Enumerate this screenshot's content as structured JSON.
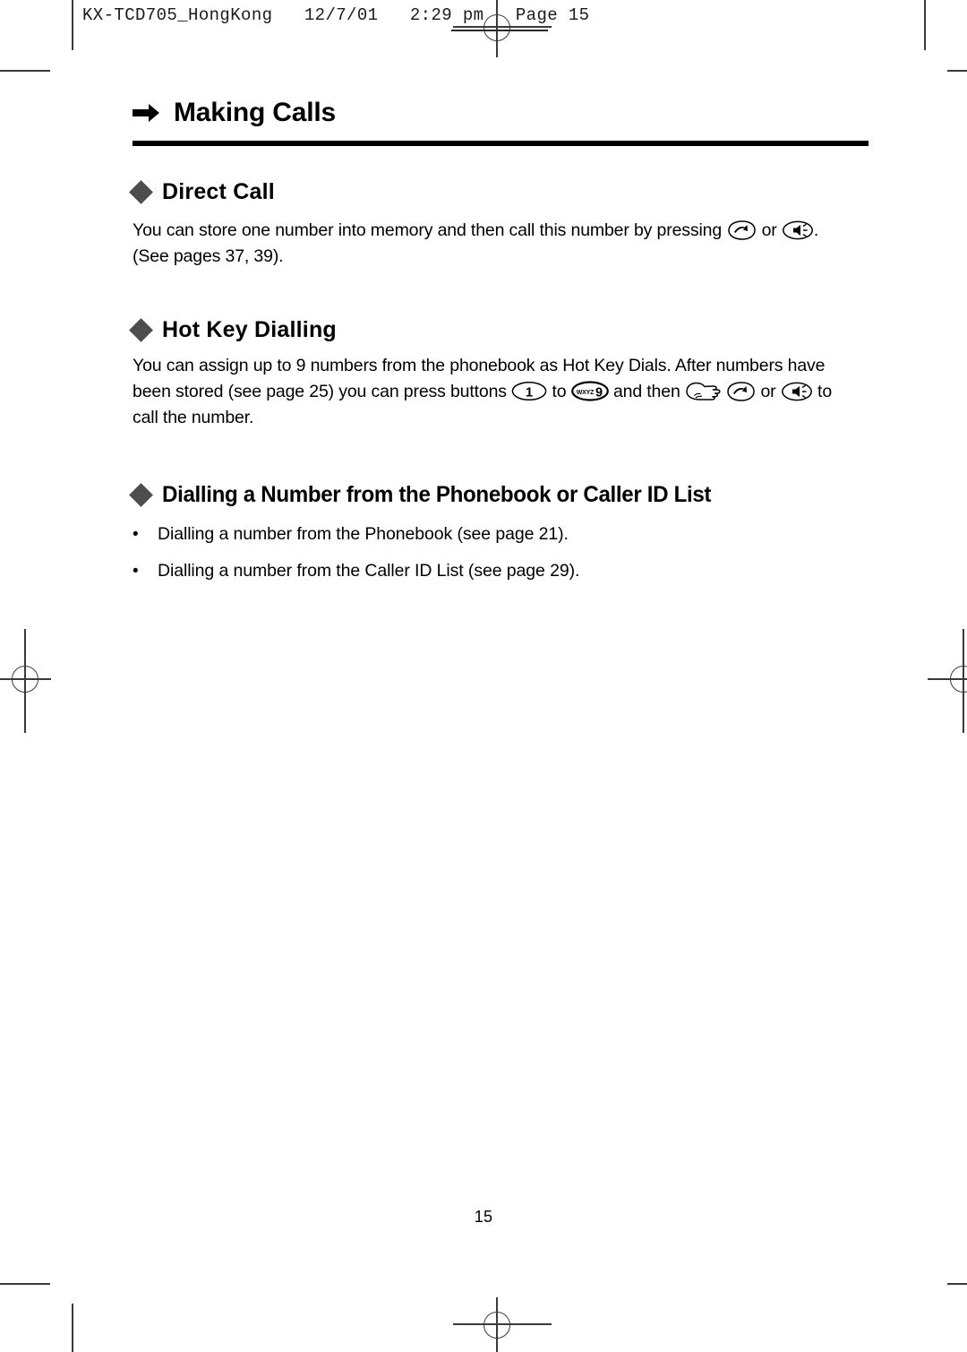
{
  "proof_header": {
    "text": "KX-TCD705_HongKong   12/7/01   2:29 pm   Page 15"
  },
  "chapter": {
    "arrow_icon": "right-arrow-icon",
    "title": "Making Calls"
  },
  "sections": [
    {
      "bullet_icon": "diamond-bullet-icon",
      "title": "Direct Call",
      "body_before_icons": "You can store one number into memory and then call this number by pressing ",
      "body_between_icons": " or ",
      "body_after_icons": ".",
      "body_line2": "(See pages 37, 39).",
      "icon1": "talk-key-icon",
      "icon2": "speakerphone-key-icon"
    },
    {
      "bullet_icon": "diamond-bullet-icon",
      "title": "Hot Key Dialling",
      "p1": "You can assign up to 9 numbers from the phonebook as Hot Key Dials. After numbers have",
      "p2a": "been stored (see page 25) you can press buttons ",
      "p2b": " to ",
      "p2c": " and then ",
      "p2d": " ",
      "p2e": " or ",
      "p2f": " to",
      "p3": "call the number.",
      "key1_label": "1",
      "key9_sublabel": "WXYZ",
      "key9_label": "9",
      "icon_hand": "pointing-hand-icon",
      "icon_talk": "talk-key-icon",
      "icon_speaker": "speakerphone-key-icon"
    },
    {
      "bullet_icon": "diamond-bullet-icon",
      "title": "Dialling a Number from the Phonebook or Caller ID List",
      "bullets": [
        {
          "marker": "•",
          "text": "Dialling a number from the Phonebook (see page 21)."
        },
        {
          "marker": "•",
          "text": "Dialling a number from the Caller ID List (see page 29)."
        }
      ]
    }
  ],
  "footer": {
    "page_number": "15"
  },
  "colors": {
    "text": "#000000",
    "diamond": "#4d4d4d",
    "rule": "#000000",
    "crop_mark": "#3a3a3a",
    "background": "#ffffff"
  }
}
